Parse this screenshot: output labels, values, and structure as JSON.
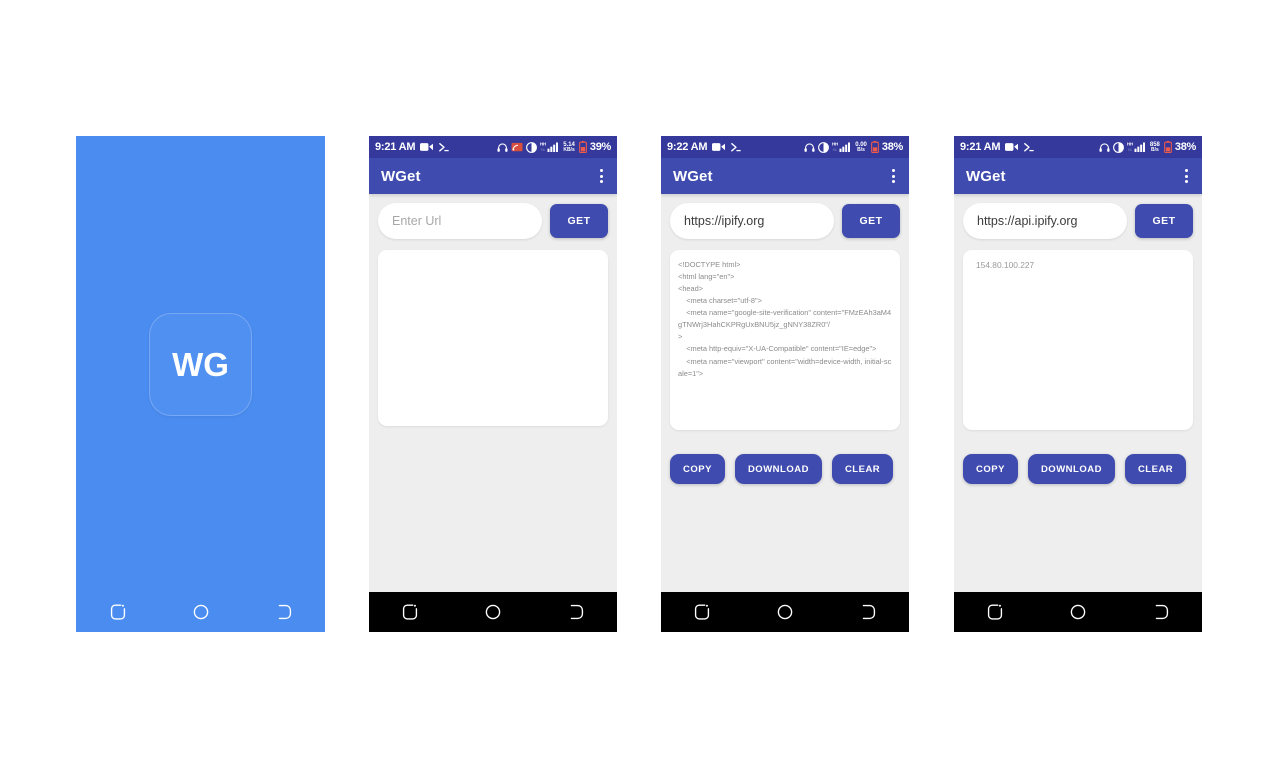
{
  "app": {
    "name": "WGet",
    "logo_text": "WG",
    "brand_color": "#3f4bae",
    "splash_color": "#4a8cf0",
    "surface_color": "#eeeeee"
  },
  "icons": {
    "overflow": "kebab-menu-icon",
    "nav_recents": "recents-icon",
    "nav_home": "home-icon",
    "nav_back": "back-icon",
    "status_screenrecord": "screen-record-icon",
    "status_terminal": "terminal-prompt-icon",
    "status_headset": "headset-icon",
    "status_cast": "cast-icon",
    "status_dnd": "do-not-disturb-icon",
    "status_signal": "signal-bars-icon",
    "status_battery": "battery-icon"
  },
  "screens": [
    {
      "id": "splash",
      "kind": "splash",
      "logo": "WG",
      "nav": {
        "recents": "recents",
        "home": "home",
        "back": "back"
      }
    },
    {
      "id": "empty",
      "kind": "app",
      "status": {
        "time": "9:21 AM",
        "speed_value": "5.14",
        "speed_unit": "KB/s",
        "battery": "39%",
        "has_cast": true
      },
      "appbar": {
        "title": "WGet"
      },
      "url": {
        "value": "",
        "placeholder": "Enter Url"
      },
      "get_label": "GET",
      "result": {
        "type": "empty",
        "text": ""
      },
      "actions": [],
      "nav": {
        "recents": "recents",
        "home": "home",
        "back": "back"
      }
    },
    {
      "id": "html-result",
      "kind": "app",
      "status": {
        "time": "9:22 AM",
        "speed_value": "0.00",
        "speed_unit": "B/s",
        "battery": "38%",
        "has_cast": false
      },
      "appbar": {
        "title": "WGet"
      },
      "url": {
        "value": "https://ipify.org",
        "placeholder": "Enter Url"
      },
      "get_label": "GET",
      "result": {
        "type": "code",
        "text": "<!DOCTYPE html>\n<html lang=\"en\">\n<head>\n    <meta charset=\"utf-8\">\n    <meta name=\"google-site-verification\" content=\"FMzEAh3aM4gTNWrj3HahCKPRgUxBNU5jz_gNNY38ZR0\"/\n>\n    <meta http-equiv=\"X-UA-Compatible\" content=\"IE=edge\">\n    <meta name=\"viewport\" content=\"width=device-width, initial-scale=1\">"
      },
      "actions": [
        "COPY",
        "DOWNLOAD",
        "CLEAR"
      ],
      "nav": {
        "recents": "recents",
        "home": "home",
        "back": "back"
      }
    },
    {
      "id": "ip-result",
      "kind": "app",
      "status": {
        "time": "9:21 AM",
        "speed_value": "858",
        "speed_unit": "B/s",
        "battery": "38%",
        "has_cast": false
      },
      "appbar": {
        "title": "WGet"
      },
      "url": {
        "value": "https://api.ipify.org",
        "placeholder": "Enter Url"
      },
      "get_label": "GET",
      "result": {
        "type": "ip",
        "text": "154.80.100.227"
      },
      "actions": [
        "COPY",
        "DOWNLOAD",
        "CLEAR"
      ],
      "nav": {
        "recents": "recents",
        "home": "home",
        "back": "back"
      }
    }
  ]
}
